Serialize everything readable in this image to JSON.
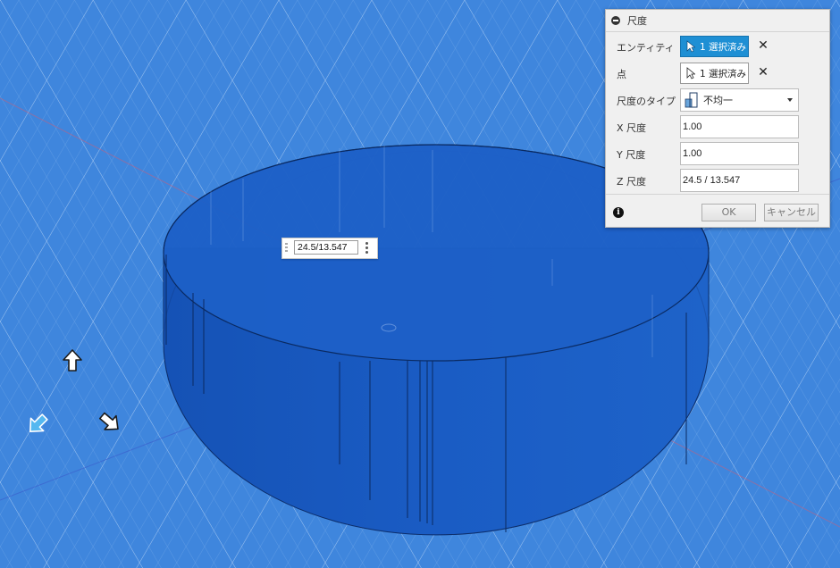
{
  "viewport": {
    "background_color": "#3f86dd",
    "body_color": "#1b5fc4",
    "grid_color": "#9cc3f2"
  },
  "dialog": {
    "title": "尺度",
    "rows": {
      "entity": {
        "label": "エンティティ",
        "value": "1 選択済み"
      },
      "point": {
        "label": "点",
        "value": "1 選択済み"
      },
      "scale_type": {
        "label": "尺度のタイプ",
        "value": "不均一",
        "icon": "non-uniform-scale-icon"
      },
      "x_scale": {
        "label": "X 尺度",
        "value": "1.00"
      },
      "y_scale": {
        "label": "Y 尺度",
        "value": "1.00"
      },
      "z_scale": {
        "label": "Z 尺度",
        "value": "24.5 / 13.547"
      }
    },
    "buttons": {
      "ok": "OK",
      "cancel": "キャンセル"
    }
  },
  "floating_input": {
    "value": "24.5/13.547"
  },
  "manipulator": {
    "handles": [
      "up-arrow-handle",
      "down-left-arrow-handle",
      "down-right-arrow-handle"
    ],
    "active_color": "#55b8f0"
  }
}
